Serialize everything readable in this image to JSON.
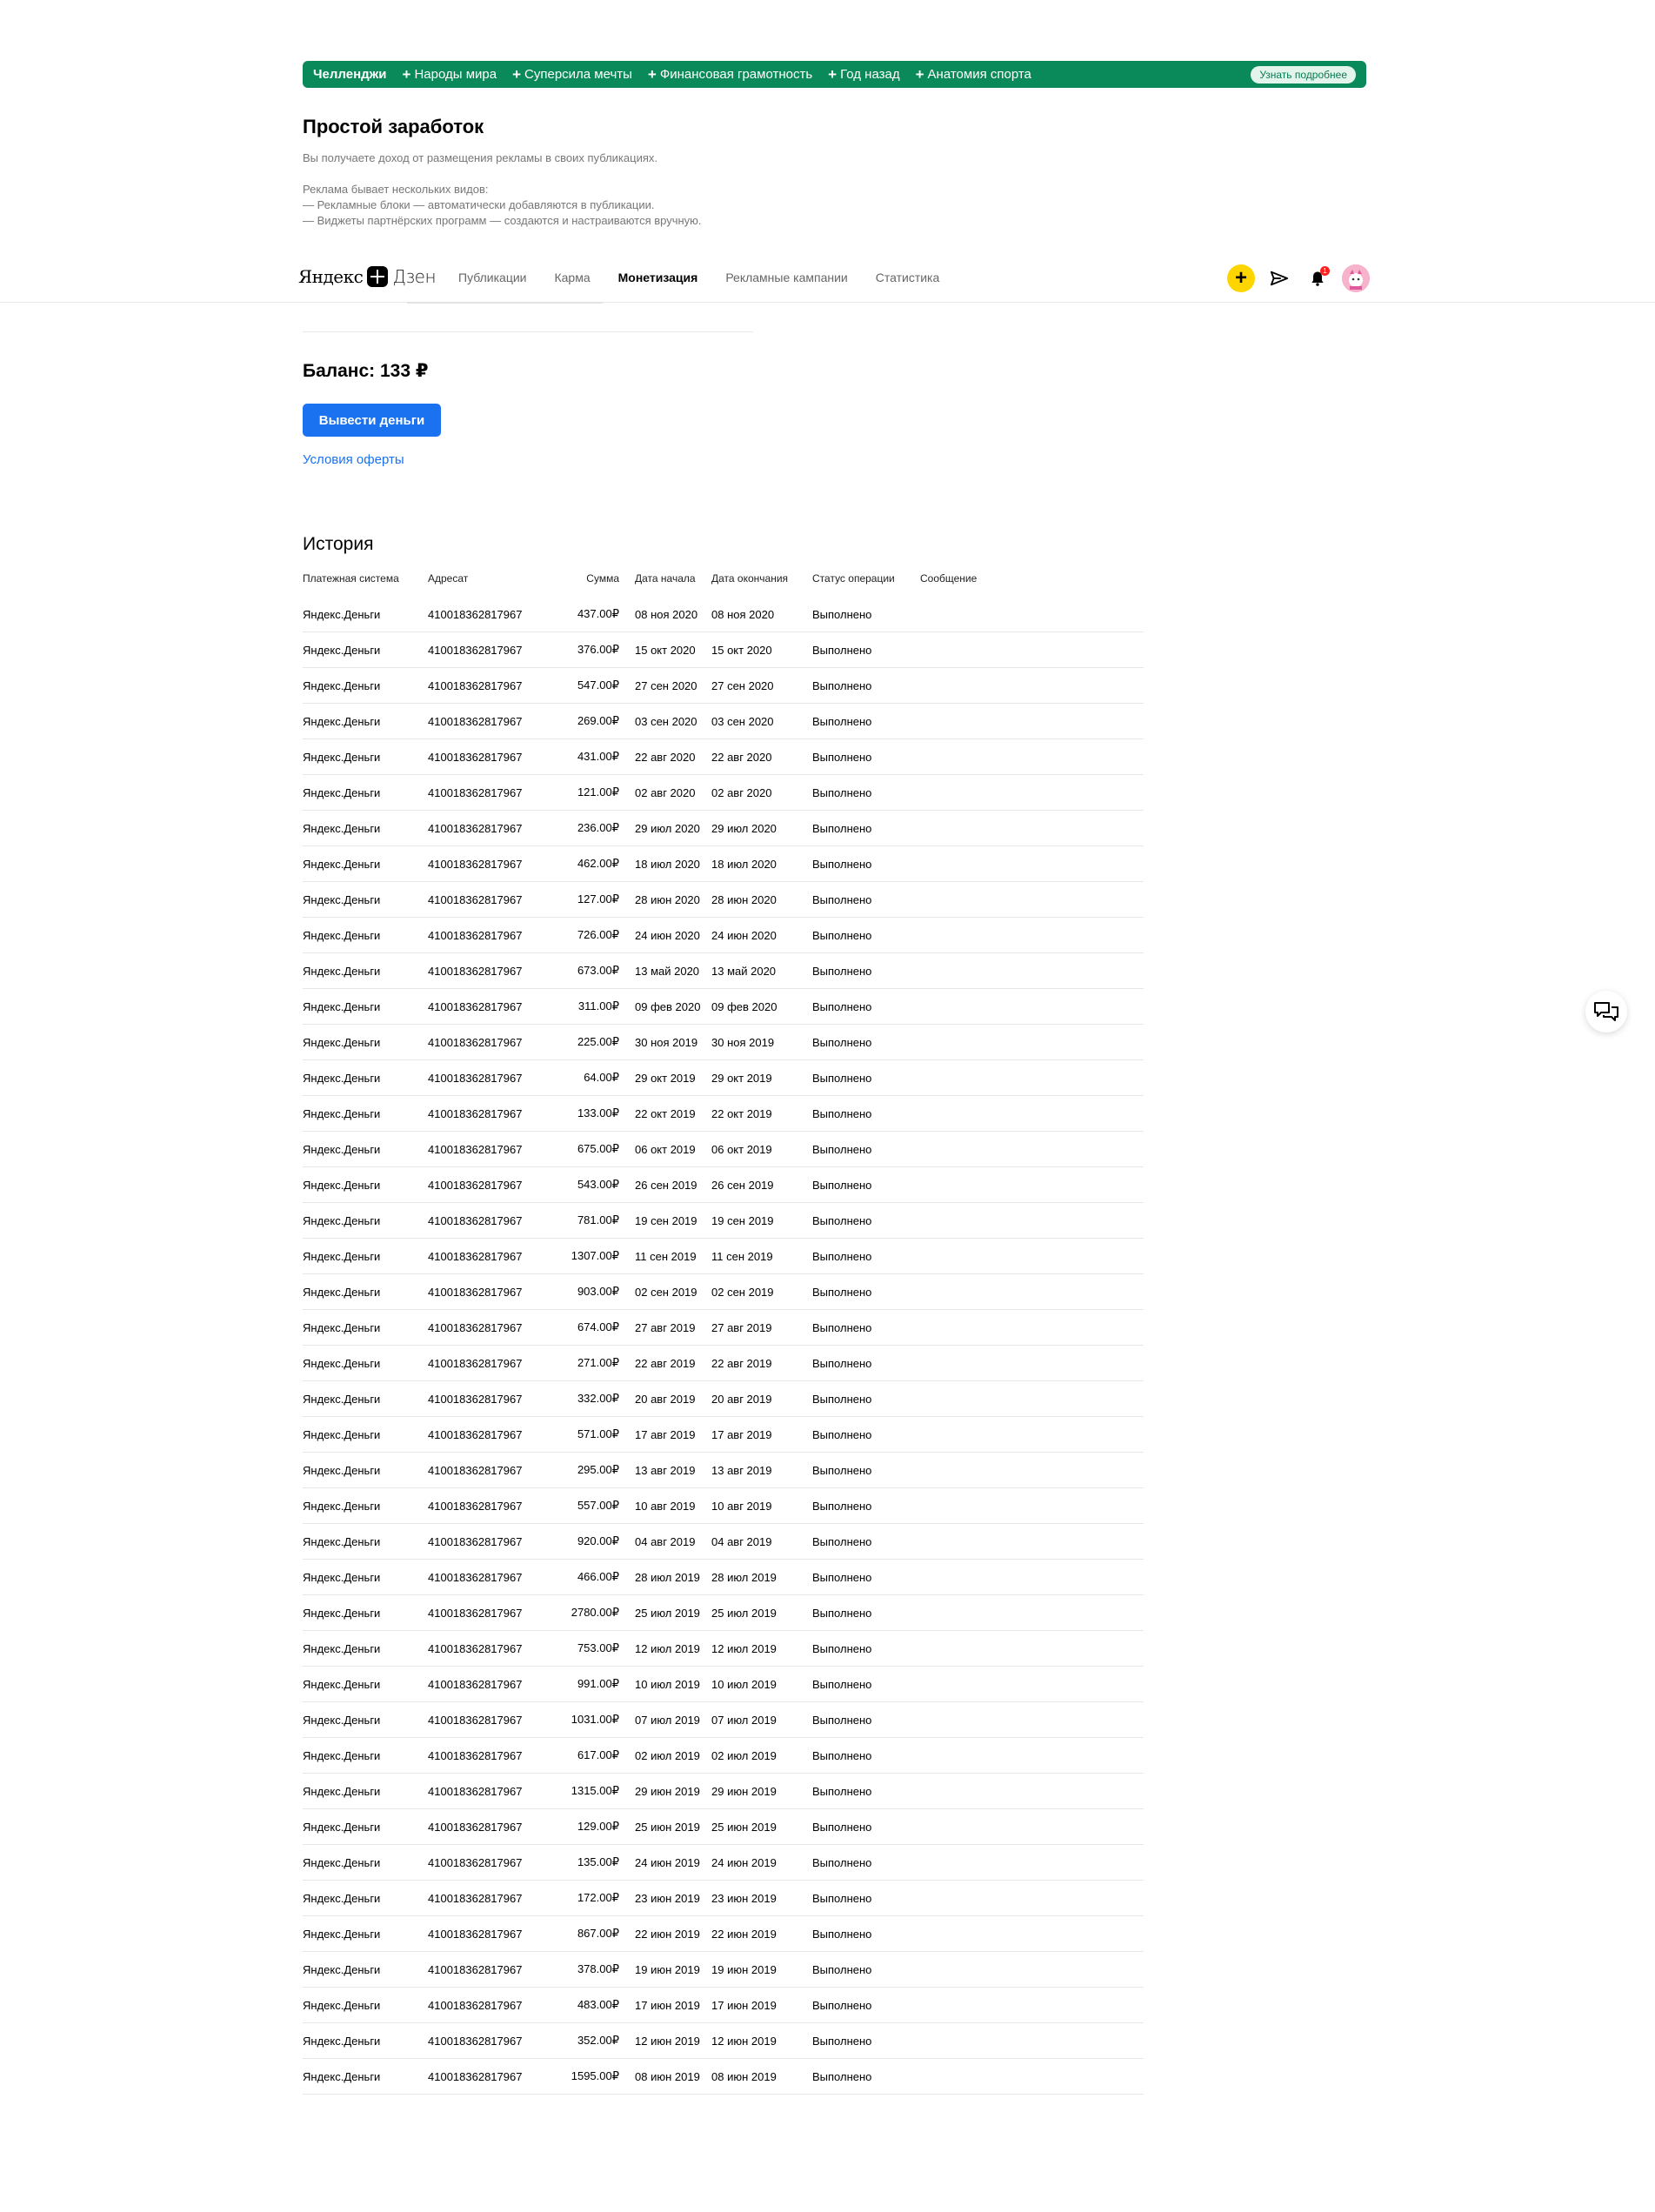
{
  "banner": {
    "title": "Челленджи",
    "chips": [
      "Народы мира",
      "Суперсила мечты",
      "Финансовая грамотность",
      "Год назад",
      "Анатомия спорта"
    ],
    "more_label": "Узнать подробнее",
    "bg_color": "#0a8a5a"
  },
  "intro": {
    "title": "Простой заработок",
    "line1": "Вы получаете доход от размещения рекламы в своих публикациях.",
    "line2": "Реклама бывает нескольких видов:",
    "line3": "— Рекламные блоки — автоматически добавляются в публикации.",
    "line4": "— Виджеты партнёрских программ — создаются и настраиваются вручную."
  },
  "nav": {
    "logo_left": "Яндекс",
    "logo_right": "Дзен",
    "links": [
      "Публикации",
      "Карма",
      "Монетизация",
      "Рекламные кампании",
      "Статистика"
    ],
    "active": "Монетизация",
    "notifications_count": "1"
  },
  "balance": {
    "label": "Баланс: 133 ₽",
    "withdraw_label": "Вывести деньги",
    "offer_label": "Условия оферты"
  },
  "history": {
    "title": "История",
    "columns": [
      "Платежная система",
      "Адресат",
      "Сумма",
      "Дата начала",
      "Дата окончания",
      "Статус операции",
      "Сообщение"
    ],
    "rows": [
      [
        "Яндекс.Деньги",
        "410018362817967",
        "437.00₽",
        "08 ноя 2020",
        "08 ноя 2020",
        "Выполнено"
      ],
      [
        "Яндекс.Деньги",
        "410018362817967",
        "376.00₽",
        "15 окт 2020",
        "15 окт 2020",
        "Выполнено"
      ],
      [
        "Яндекс.Деньги",
        "410018362817967",
        "547.00₽",
        "27 сен 2020",
        "27 сен 2020",
        "Выполнено"
      ],
      [
        "Яндекс.Деньги",
        "410018362817967",
        "269.00₽",
        "03 сен 2020",
        "03 сен 2020",
        "Выполнено"
      ],
      [
        "Яндекс.Деньги",
        "410018362817967",
        "431.00₽",
        "22 авг 2020",
        "22 авг 2020",
        "Выполнено"
      ],
      [
        "Яндекс.Деньги",
        "410018362817967",
        "121.00₽",
        "02 авг 2020",
        "02 авг 2020",
        "Выполнено"
      ],
      [
        "Яндекс.Деньги",
        "410018362817967",
        "236.00₽",
        "29 июл 2020",
        "29 июл 2020",
        "Выполнено"
      ],
      [
        "Яндекс.Деньги",
        "410018362817967",
        "462.00₽",
        "18 июл 2020",
        "18 июл 2020",
        "Выполнено"
      ],
      [
        "Яндекс.Деньги",
        "410018362817967",
        "127.00₽",
        "28 июн 2020",
        "28 июн 2020",
        "Выполнено"
      ],
      [
        "Яндекс.Деньги",
        "410018362817967",
        "726.00₽",
        "24 июн 2020",
        "24 июн 2020",
        "Выполнено"
      ],
      [
        "Яндекс.Деньги",
        "410018362817967",
        "673.00₽",
        "13 май 2020",
        "13 май 2020",
        "Выполнено"
      ],
      [
        "Яндекс.Деньги",
        "410018362817967",
        "311.00₽",
        "09 фев 2020",
        "09 фев 2020",
        "Выполнено"
      ],
      [
        "Яндекс.Деньги",
        "410018362817967",
        "225.00₽",
        "30 ноя 2019",
        "30 ноя 2019",
        "Выполнено"
      ],
      [
        "Яндекс.Деньги",
        "410018362817967",
        "64.00₽",
        "29 окт 2019",
        "29 окт 2019",
        "Выполнено"
      ],
      [
        "Яндекс.Деньги",
        "410018362817967",
        "133.00₽",
        "22 окт 2019",
        "22 окт 2019",
        "Выполнено"
      ],
      [
        "Яндекс.Деньги",
        "410018362817967",
        "675.00₽",
        "06 окт 2019",
        "06 окт 2019",
        "Выполнено"
      ],
      [
        "Яндекс.Деньги",
        "410018362817967",
        "543.00₽",
        "26 сен 2019",
        "26 сен 2019",
        "Выполнено"
      ],
      [
        "Яндекс.Деньги",
        "410018362817967",
        "781.00₽",
        "19 сен 2019",
        "19 сен 2019",
        "Выполнено"
      ],
      [
        "Яндекс.Деньги",
        "410018362817967",
        "1307.00₽",
        "11 сен 2019",
        "11 сен 2019",
        "Выполнено"
      ],
      [
        "Яндекс.Деньги",
        "410018362817967",
        "903.00₽",
        "02 сен 2019",
        "02 сен 2019",
        "Выполнено"
      ],
      [
        "Яндекс.Деньги",
        "410018362817967",
        "674.00₽",
        "27 авг 2019",
        "27 авг 2019",
        "Выполнено"
      ],
      [
        "Яндекс.Деньги",
        "410018362817967",
        "271.00₽",
        "22 авг 2019",
        "22 авг 2019",
        "Выполнено"
      ],
      [
        "Яндекс.Деньги",
        "410018362817967",
        "332.00₽",
        "20 авг 2019",
        "20 авг 2019",
        "Выполнено"
      ],
      [
        "Яндекс.Деньги",
        "410018362817967",
        "571.00₽",
        "17 авг 2019",
        "17 авг 2019",
        "Выполнено"
      ],
      [
        "Яндекс.Деньги",
        "410018362817967",
        "295.00₽",
        "13 авг 2019",
        "13 авг 2019",
        "Выполнено"
      ],
      [
        "Яндекс.Деньги",
        "410018362817967",
        "557.00₽",
        "10 авг 2019",
        "10 авг 2019",
        "Выполнено"
      ],
      [
        "Яндекс.Деньги",
        "410018362817967",
        "920.00₽",
        "04 авг 2019",
        "04 авг 2019",
        "Выполнено"
      ],
      [
        "Яндекс.Деньги",
        "410018362817967",
        "466.00₽",
        "28 июл 2019",
        "28 июл 2019",
        "Выполнено"
      ],
      [
        "Яндекс.Деньги",
        "410018362817967",
        "2780.00₽",
        "25 июл 2019",
        "25 июл 2019",
        "Выполнено"
      ],
      [
        "Яндекс.Деньги",
        "410018362817967",
        "753.00₽",
        "12 июл 2019",
        "12 июл 2019",
        "Выполнено"
      ],
      [
        "Яндекс.Деньги",
        "410018362817967",
        "991.00₽",
        "10 июл 2019",
        "10 июл 2019",
        "Выполнено"
      ],
      [
        "Яндекс.Деньги",
        "410018362817967",
        "1031.00₽",
        "07 июл 2019",
        "07 июл 2019",
        "Выполнено"
      ],
      [
        "Яндекс.Деньги",
        "410018362817967",
        "617.00₽",
        "02 июл 2019",
        "02 июл 2019",
        "Выполнено"
      ],
      [
        "Яндекс.Деньги",
        "410018362817967",
        "1315.00₽",
        "29 июн 2019",
        "29 июн 2019",
        "Выполнено"
      ],
      [
        "Яндекс.Деньги",
        "410018362817967",
        "129.00₽",
        "25 июн 2019",
        "25 июн 2019",
        "Выполнено"
      ],
      [
        "Яндекс.Деньги",
        "410018362817967",
        "135.00₽",
        "24 июн 2019",
        "24 июн 2019",
        "Выполнено"
      ],
      [
        "Яндекс.Деньги",
        "410018362817967",
        "172.00₽",
        "23 июн 2019",
        "23 июн 2019",
        "Выполнено"
      ],
      [
        "Яндекс.Деньги",
        "410018362817967",
        "867.00₽",
        "22 июн 2019",
        "22 июн 2019",
        "Выполнено"
      ],
      [
        "Яндекс.Деньги",
        "410018362817967",
        "378.00₽",
        "19 июн 2019",
        "19 июн 2019",
        "Выполнено"
      ],
      [
        "Яндекс.Деньги",
        "410018362817967",
        "483.00₽",
        "17 июн 2019",
        "17 июн 2019",
        "Выполнено"
      ],
      [
        "Яндекс.Деньги",
        "410018362817967",
        "352.00₽",
        "12 июн 2019",
        "12 июн 2019",
        "Выполнено"
      ],
      [
        "Яндекс.Деньги",
        "410018362817967",
        "1595.00₽",
        "08 июн 2019",
        "08 июн 2019",
        "Выполнено"
      ]
    ]
  },
  "icons": {
    "plus": "plus-icon",
    "send": "paper-plane-icon",
    "bell": "bell-icon",
    "chat": "chat-bubbles-icon"
  },
  "colors": {
    "accent_blue": "#1a72f0",
    "plus_yellow": "#ffd500",
    "avatar_pink": "#f7b2cc"
  }
}
